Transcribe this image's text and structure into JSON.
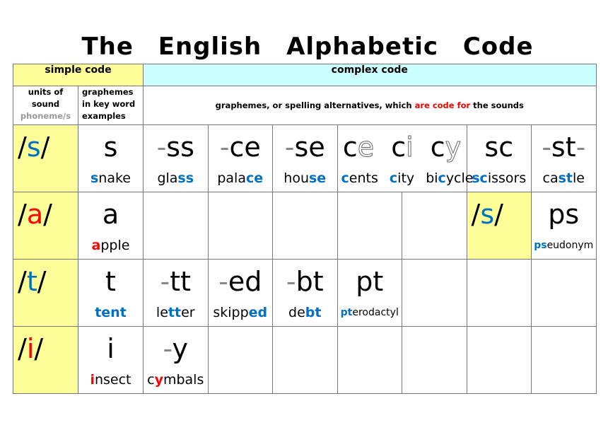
{
  "title": "The English Alphabetic Code",
  "header": {
    "simple_code": "simple code",
    "complex_code": "complex code",
    "col_units": [
      "units of",
      "sound"
    ],
    "col_units_sub": "phoneme/s",
    "col_graphemes": [
      "graphemes",
      "in key word",
      "examples"
    ],
    "col_alternatives_pre": "graphemes, or spelling alternatives, which ",
    "col_alternatives_red": "are code for",
    "col_alternatives_post": " the sounds"
  },
  "colors": {
    "simple_bg": "#ffff99",
    "complex_bg": "#ccffff",
    "consonant_highlight": "#0070c0",
    "vowel_highlight": "#ff0000",
    "grid": "#777777"
  },
  "rows": [
    {
      "phoneme": {
        "pre": "/",
        "sound": "s",
        "post": "/",
        "color": "blue"
      },
      "simple": {
        "grapheme": "s",
        "word_hl": "s",
        "word_rest": "nake"
      },
      "s_ss": {
        "dash": "-",
        "g": "ss",
        "pre": "gla",
        "hl": "ss",
        "post": ""
      },
      "s_ce": {
        "dash": "-",
        "g": "ce",
        "pre": "pala",
        "hl": "ce",
        "post": ""
      },
      "s_se": {
        "dash": "-",
        "g": "se",
        "pre": "hou",
        "hl": "se",
        "post": ""
      },
      "s_soft_c": [
        {
          "c": "c",
          "v": "e",
          "pre": "",
          "hl": "c",
          "post": "ents"
        },
        {
          "c": "c",
          "v": "i",
          "pre": "",
          "hl": "c",
          "post": "ity"
        },
        {
          "c": "c",
          "v": "y",
          "pre": "bi",
          "hl": "c",
          "post": "ycle"
        }
      ],
      "s_sc": {
        "g": "sc",
        "pre": "",
        "hl": "sc",
        "post": "issors"
      },
      "s_st": {
        "dash_l": "-",
        "g": "st",
        "dash_r": "-",
        "pre": "ca",
        "hl": "st",
        "post": "le"
      }
    },
    {
      "phoneme": {
        "pre": "/",
        "sound": "a",
        "post": "/",
        "color": "red"
      },
      "simple": {
        "grapheme": "a",
        "word_hl": "a",
        "word_rest": "pple"
      },
      "inline_phoneme": {
        "pre": "/",
        "sound": "s",
        "post": "/"
      },
      "s_ps": {
        "g": "ps",
        "pre": "",
        "hl": "ps",
        "post": "eudonym"
      }
    },
    {
      "phoneme": {
        "pre": "/",
        "sound": "t",
        "post": "/",
        "color": "blue"
      },
      "simple": {
        "grapheme": "t",
        "word_hl": "t",
        "word_mid": "en",
        "word_hl2": "t"
      },
      "t_tt": {
        "dash": "-",
        "g": "tt",
        "pre": "le",
        "hl": "tt",
        "post": "er"
      },
      "t_ed": {
        "dash": "-",
        "g": "ed",
        "pre": "skipp",
        "hl": "ed",
        "post": ""
      },
      "t_bt": {
        "dash": "-",
        "g": "bt",
        "pre": "de",
        "hl": "bt",
        "post": ""
      },
      "t_pt": {
        "g": "pt",
        "pre": "",
        "hl": "pt",
        "post": "erodactyl"
      }
    },
    {
      "phoneme": {
        "pre": "/",
        "sound": "i",
        "post": "/",
        "color": "red"
      },
      "simple": {
        "grapheme": "i",
        "word_hl": "i",
        "word_rest": "nsect"
      },
      "i_y": {
        "dash": "-",
        "g": "y",
        "pre": "c",
        "hl": "y",
        "post": "mbals"
      }
    }
  ]
}
